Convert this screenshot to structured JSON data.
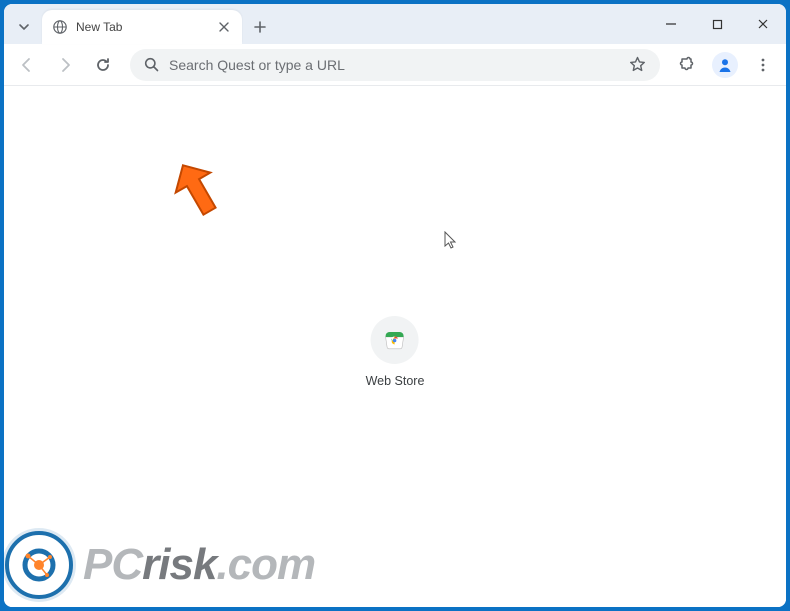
{
  "tab": {
    "title": "New Tab"
  },
  "omnibox": {
    "placeholder": "Search Quest or type a URL"
  },
  "shortcuts": {
    "webstore": {
      "label": "Web Store"
    }
  },
  "watermark": {
    "text_plain": "PC",
    "text_accent": "risk",
    "domain": ".com"
  }
}
